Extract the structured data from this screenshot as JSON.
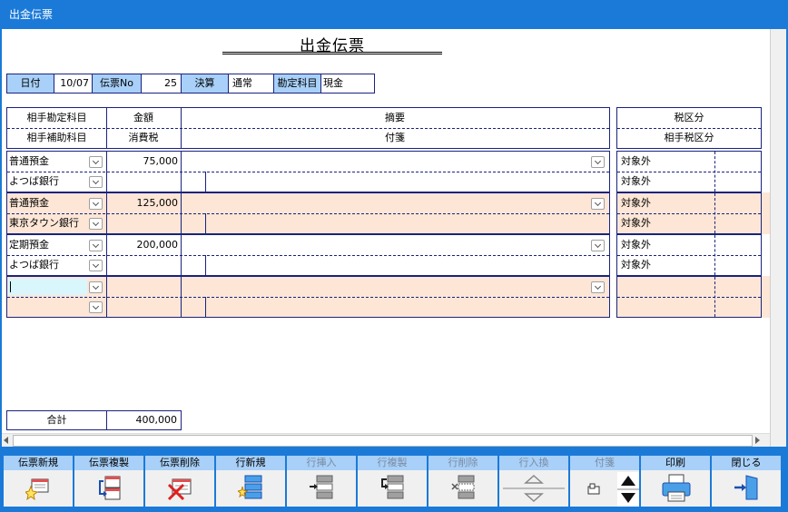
{
  "window": {
    "title": "出金伝票"
  },
  "document": {
    "title": "出金伝票"
  },
  "header": {
    "date_label": "日付",
    "date_value": "10/07",
    "slip_no_label": "伝票No",
    "slip_no_value": "25",
    "settlement_label": "決算",
    "settlement_value": "通常",
    "account_label": "勘定科目",
    "account_value": "現金"
  },
  "columns": {
    "account": "相手勘定科目",
    "sub_account": "相手補助科目",
    "amount": "金額",
    "tax": "消費税",
    "summary": "摘要",
    "note": "付箋",
    "tax_class": "税区分",
    "partner_tax_class": "相手税区分"
  },
  "rows": [
    {
      "account": "普通預金",
      "sub_account": "よつば銀行",
      "amount": "75,000",
      "tax_class": "対象外",
      "partner_tax_class": "対象外"
    },
    {
      "account": "普通預金",
      "sub_account": "東京タウン銀行",
      "amount": "125,000",
      "tax_class": "対象外",
      "partner_tax_class": "対象外"
    },
    {
      "account": "定期預金",
      "sub_account": "よつば銀行",
      "amount": "200,000",
      "tax_class": "対象外",
      "partner_tax_class": "対象外"
    },
    {
      "account": "",
      "sub_account": "",
      "amount": "",
      "tax_class": "",
      "partner_tax_class": ""
    }
  ],
  "total": {
    "label": "合計",
    "value": "400,000"
  },
  "toolbar": {
    "buttons": [
      {
        "label": "伝票新規",
        "icon": "new-slip-icon",
        "enabled": true
      },
      {
        "label": "伝票複製",
        "icon": "copy-slip-icon",
        "enabled": true
      },
      {
        "label": "伝票削除",
        "icon": "delete-slip-icon",
        "enabled": true
      },
      {
        "label": "行新規",
        "icon": "new-row-icon",
        "enabled": true
      },
      {
        "label": "行挿入",
        "icon": "insert-row-icon",
        "enabled": false
      },
      {
        "label": "行複製",
        "icon": "copy-row-icon",
        "enabled": false
      },
      {
        "label": "行削除",
        "icon": "delete-row-icon",
        "enabled": false
      },
      {
        "label": "行入換",
        "icon": "swap-row-icon",
        "enabled": false
      },
      {
        "label": "付箋",
        "icon": "sticky-note-icon",
        "enabled": false
      },
      {
        "label": "印刷",
        "icon": "printer-icon",
        "enabled": true
      },
      {
        "label": "閉じる",
        "icon": "exit-door-icon",
        "enabled": true
      }
    ]
  },
  "colors": {
    "accent": "#1b7ad8",
    "label_bg": "#a8d0f8",
    "row_highlight": "#fde6d6",
    "selected_cell": "#d8f6fb",
    "grid_line": "#1a237e"
  }
}
